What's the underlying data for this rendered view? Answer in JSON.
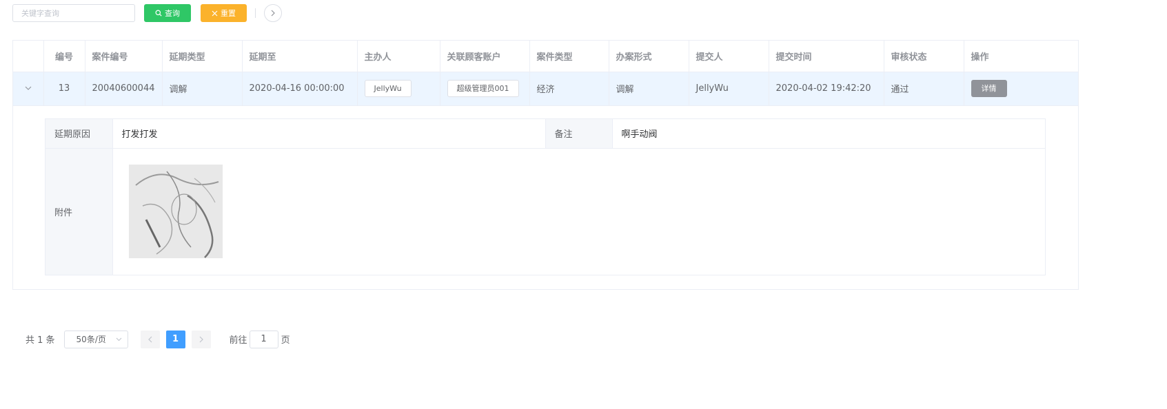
{
  "search": {
    "placeholder": "关键字查询",
    "value": ""
  },
  "toolbar": {
    "query_label": "查询",
    "reset_label": "重置"
  },
  "table": {
    "headers": [
      "",
      "编号",
      "案件编号",
      "延期类型",
      "延期至",
      "主办人",
      "关联顾客账户",
      "案件类型",
      "办案形式",
      "提交人",
      "提交时间",
      "审核状态",
      "操作"
    ],
    "rows": [
      {
        "id": "13",
        "case_no": "20040600044",
        "delay_type": "调解",
        "delay_to": "2020-04-16 00:00:00",
        "host": "JellyWu",
        "customer": "超级管理员001",
        "case_type": "经济",
        "handling": "调解",
        "submitter": "JellyWu",
        "submit_time": "2020-04-02 19:42:20",
        "status": "通过",
        "action": "详情"
      }
    ]
  },
  "expanded": {
    "reason_label": "延期原因",
    "reason_value": "打发打发",
    "remark_label": "备注",
    "remark_value": "啊手动阀",
    "attachment_label": "附件"
  },
  "pagination": {
    "total_text": "共 1 条",
    "page_size": "50条/页",
    "current_page": "1",
    "goto_label": "前往",
    "goto_value": "1",
    "goto_suffix": "页"
  },
  "colors": {
    "query_button": "#2fc766",
    "reset_button": "#fbb22b",
    "active_page": "#409eff",
    "row_highlight": "#ecf5ff",
    "detail_button": "#909399"
  }
}
